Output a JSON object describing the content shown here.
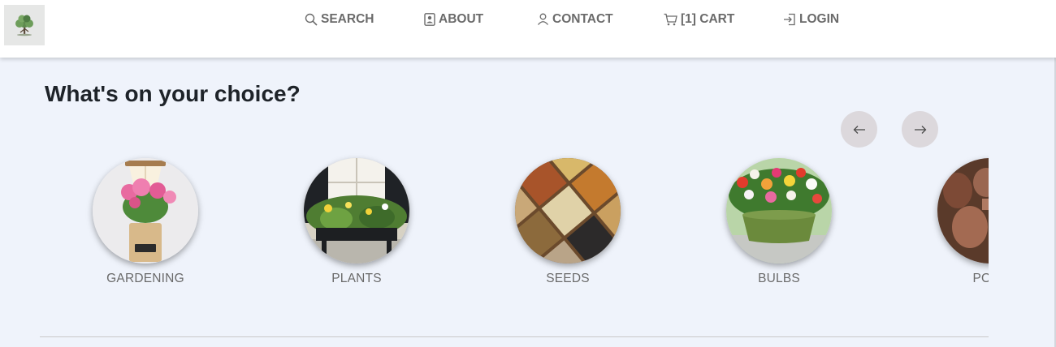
{
  "nav": {
    "search_label": "SEARCH",
    "about_label": "ABOUT",
    "contact_label": "CONTACT",
    "cart_label": "[1] CART",
    "login_label": "LOGIN"
  },
  "main": {
    "heading": "What's on your choice?"
  },
  "categories": [
    {
      "label": "GARDENING"
    },
    {
      "label": "PLANTS"
    },
    {
      "label": "SEEDS"
    },
    {
      "label": "BULBS"
    },
    {
      "label": "POTS"
    }
  ],
  "icons": {
    "logo": "tree-logo-icon",
    "search": "search-icon",
    "about": "contact-card-icon",
    "contact": "user-icon",
    "cart": "cart-icon",
    "login": "login-icon",
    "prev": "arrow-left-icon",
    "next": "arrow-right-icon"
  },
  "colors": {
    "page_bg": "#eff3fb",
    "nav_bg": "#ffffff",
    "nav_text": "#6b6b6b",
    "heading_text": "#1e2329",
    "arrow_button_bg": "#dcd8dc"
  }
}
